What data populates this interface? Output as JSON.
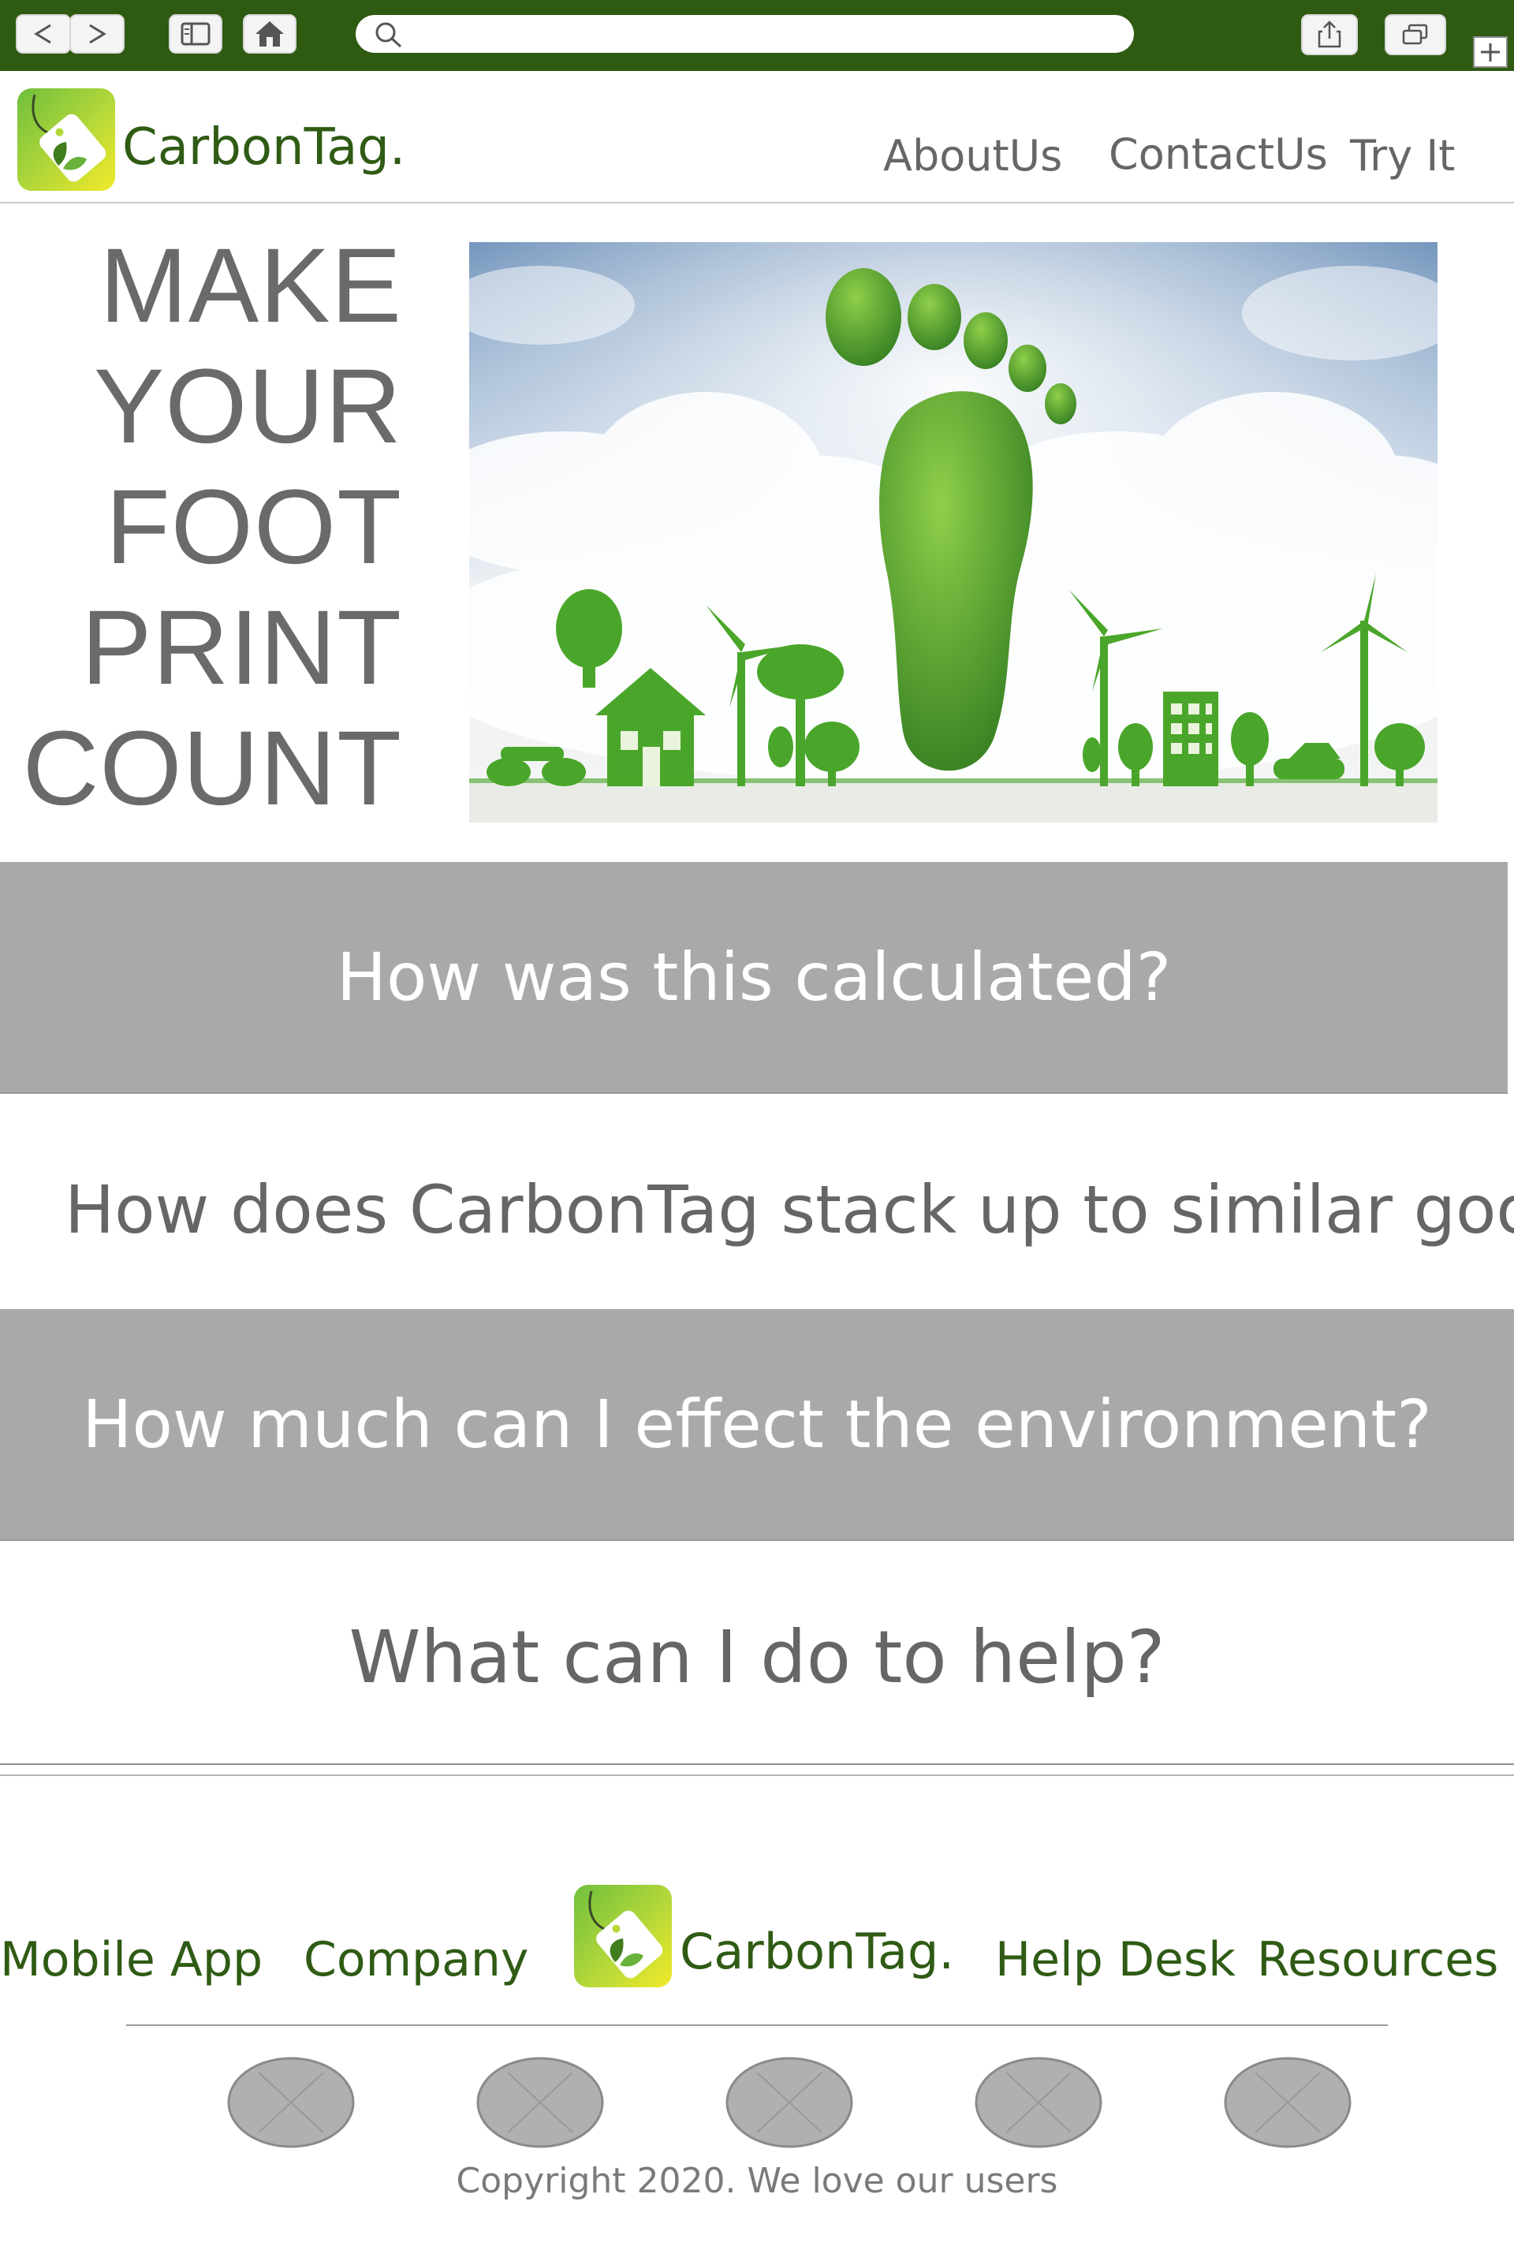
{
  "browser": {
    "back_icon": "chevron-left-icon",
    "forward_icon": "chevron-right-icon",
    "sidebar_icon": "sidebar-icon",
    "home_icon": "home-icon",
    "search_icon": "search-icon",
    "share_icon": "share-icon",
    "tabs_icon": "tabs-icon",
    "new_tab_icon": "plus-icon",
    "url": ""
  },
  "header": {
    "brand": "CarbonTag.",
    "nav": [
      "AboutUs",
      "ContactUs",
      "Try It"
    ]
  },
  "hero": {
    "lines": [
      "MAKE",
      "YOUR",
      "FOOT",
      "PRINT",
      "COUNT"
    ]
  },
  "faq": [
    "How was this calculated?",
    "How does CarbonTag stack up to similar goods?",
    "How much can I effect the environment?",
    "What can I do to help?"
  ],
  "footer": {
    "links_left": [
      "Mobile App",
      "Company"
    ],
    "brand": "CarbonTag.",
    "links_right": [
      "Help Desk",
      "Resources"
    ],
    "social_count": 5,
    "copyright": "Copyright 2020. We love our users"
  },
  "colors": {
    "chrome": "#2e5a12",
    "brand_green": "#2f5b14",
    "band_gray": "#a9a9a9",
    "text_gray": "#666666"
  }
}
